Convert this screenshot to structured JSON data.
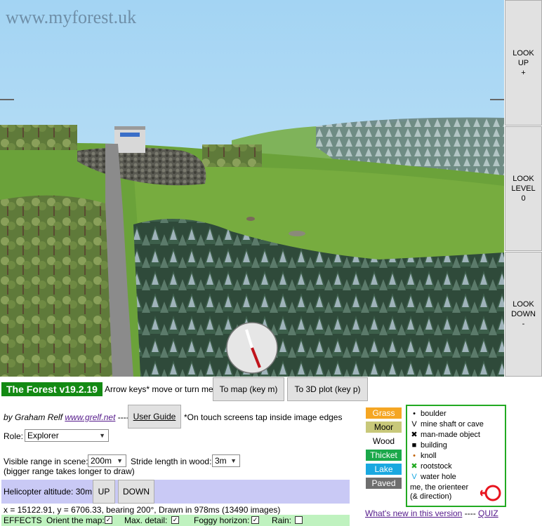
{
  "scene": {
    "watermark": "www.myforest.uk"
  },
  "look_buttons": {
    "up": "LOOK\nUP\n+",
    "level": "LOOK\nLEVEL\n0",
    "down": "LOOK\nDOWN\n-"
  },
  "controls": {
    "title": "The Forest v19.2.19",
    "arrow_hint": "Arrow keys* move or turn me",
    "to_map": "To map (key m)",
    "to_3d": "To 3D plot (key p)",
    "byline_prefix": "by Graham Relf",
    "author_link": "www.grelf.net",
    "byline_sep": "----",
    "user_guide": "User Guide",
    "touch_note": "*On touch screens tap inside image edges",
    "role_label": "Role:",
    "role_value": "Explorer",
    "range_label": "Visible range in scene:",
    "range_value": "200m",
    "stride_label": "Stride length in wood:",
    "stride_value": "3m",
    "range_note": "(bigger range takes longer to draw)",
    "heli_label": "Helicopter altitude: 30m",
    "up": "UP",
    "down": "DOWN",
    "status": "x = 15122.91, y = 6706.33, bearing 200°, Drawn in 978ms (13490 images)",
    "effects_label": "EFFECTS",
    "orient_label": "Orient the map:",
    "detail_label": "Max. detail:",
    "fog_label": "Foggy horizon:",
    "rain_label": "Rain:",
    "orient_checked": true,
    "detail_checked": true,
    "fog_checked": true,
    "rain_checked": false,
    "whats_new": "What's new in this version",
    "quiz_sep": "----",
    "quiz": "QUIZ"
  },
  "terrain_legend": [
    {
      "label": "Grass",
      "bg": "#f5a623",
      "fg": "#ffffff"
    },
    {
      "label": "Moor",
      "bg": "#c8c87a",
      "fg": "#000000"
    },
    {
      "label": "Wood",
      "bg": "#ffffff",
      "fg": "#000000"
    },
    {
      "label": "Thicket",
      "bg": "#1aa84a",
      "fg": "#ffffff"
    },
    {
      "label": "Lake",
      "bg": "#1aa8e0",
      "fg": "#ffffff"
    },
    {
      "label": "Paved",
      "bg": "#6e6e6e",
      "fg": "#ffffff"
    }
  ],
  "feature_legend": [
    {
      "symbol": "•",
      "label": "boulder",
      "icon": "boulder-icon",
      "color": "#000000"
    },
    {
      "symbol": "V",
      "label": "mine shaft or cave",
      "icon": "mine-shaft-icon",
      "color": "#000000"
    },
    {
      "symbol": "✖",
      "label": "man-made object",
      "icon": "man-made-object-icon",
      "color": "#000000"
    },
    {
      "symbol": "■",
      "label": "building",
      "icon": "building-icon",
      "color": "#000000"
    },
    {
      "symbol": "•",
      "label": "knoll",
      "icon": "knoll-icon",
      "color": "#c06000"
    },
    {
      "symbol": "✖",
      "label": "rootstock",
      "icon": "rootstock-icon",
      "color": "#22aa22"
    },
    {
      "symbol": "V",
      "label": "water hole",
      "icon": "water-hole-icon",
      "color": "#1aa8e0"
    }
  ],
  "orienteer_legend": "me, the orienteer\n(& direction)",
  "colors": {
    "title_bg": "#138a13",
    "legend_border": "#22aa22",
    "heli_bar": "#c9c9f5",
    "effects_bar": "#bff2bf",
    "orienteer": "#e8141e"
  }
}
